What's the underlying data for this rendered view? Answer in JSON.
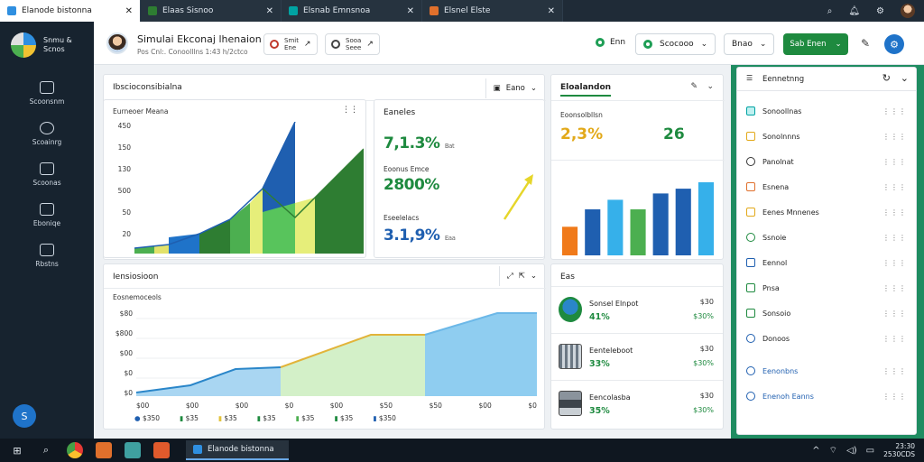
{
  "tabs": [
    {
      "label": "Elanode bistonna",
      "icon": "app-logo-icon",
      "color": "#2f8fe0"
    },
    {
      "label": "Elaas Sisnoo",
      "icon": "grid-icon",
      "color": "#2e7d32"
    },
    {
      "label": "Elsnab Emnsnoa",
      "icon": "grid-icon",
      "color": "#00a3a3"
    },
    {
      "label": "Elsnel Elste",
      "icon": "grid-icon",
      "color": "#e0702c"
    }
  ],
  "sidebar": {
    "brand": {
      "line1": "Snmu &",
      "line2": "Scnos"
    },
    "items": [
      {
        "label": "Scoonsnm",
        "icon": "home-icon"
      },
      {
        "label": "Scoainrg",
        "icon": "clock-icon"
      },
      {
        "label": "Scoonas",
        "icon": "calendar-icon"
      },
      {
        "label": "Eboniqe",
        "icon": "chart-icon"
      },
      {
        "label": "Rbstns",
        "icon": "document-icon"
      }
    ],
    "help": "S"
  },
  "header": {
    "title": "Simulai Ekconaj lhenaion",
    "subtitle": "Pos Cnl:. Conoolllns 1:43 h/2ctco",
    "chip1": {
      "line1": "Smit",
      "line2": "Ene"
    },
    "chip2": {
      "line1": "Sooa",
      "line2": "Seee"
    },
    "status": "Enn",
    "pill_value": "Scocooo",
    "filter": "Bnao",
    "primary": "Sab Enen"
  },
  "card_chart1": {
    "title": "Ibscioconsibialna",
    "control": "Eano",
    "subtitle": "Eurneoer Meana",
    "yticks": [
      "450",
      "150",
      "130",
      "500",
      "50",
      "20"
    ]
  },
  "card_metrics": {
    "title": "Eaneles",
    "m1": {
      "label": "",
      "value": "7,1.3%",
      "unit": "Bat",
      "color": "#1e8a3f"
    },
    "m2": {
      "label": "Eoonus Emce",
      "value": "2800%",
      "unit": "",
      "color": "#1e8a3f"
    },
    "m3": {
      "label": "Eseelelacs",
      "value": "3.1,9%",
      "unit": "Eaa",
      "color": "#1f5fb0"
    }
  },
  "card_bars": {
    "title": "Eloalandon",
    "subtitle": "Eoonsolbllsn",
    "left_value": "2,3%",
    "right_value": "26",
    "chart_data": {
      "type": "bar",
      "values": [
        1.8,
        2.9,
        3.5,
        2.9,
        3.9,
        4.2,
        4.6
      ],
      "colors": [
        "#f07a1a",
        "#1f5fb0",
        "#36b0ea",
        "#4caf50",
        "#1f5fb0",
        "#1f5fb0",
        "#36b0ea"
      ],
      "ylim": [
        0,
        5
      ]
    }
  },
  "card_chart2": {
    "title": "Iensiosioon",
    "subtitle": "Eosnemoceols",
    "yticks": [
      "$80",
      "$800",
      "$00",
      "$0",
      "$0"
    ],
    "xticks": [
      "$00",
      "$00",
      "$00",
      "$0",
      "$00",
      "$50",
      "$50",
      "$00",
      "$0"
    ],
    "legend": [
      {
        "label": "$350",
        "color": "#1f5fb0"
      },
      {
        "label": "$35",
        "color": "#1e8a3f"
      },
      {
        "label": "$35",
        "color": "#e2c23a"
      },
      {
        "label": "$35",
        "color": "#1e8a3f"
      },
      {
        "label": "$35",
        "color": "#4caf50"
      },
      {
        "label": "$35",
        "color": "#1e8a3f"
      },
      {
        "label": "$350",
        "color": "#1f5fb0"
      }
    ]
  },
  "card_list": {
    "title": "Eas",
    "rows": [
      {
        "name": "Sonsel Elnpot",
        "pct": "41%",
        "r1": "$30",
        "r2": "$30%"
      },
      {
        "name": "Eenteleboot",
        "pct": "33%",
        "r1": "$30",
        "r2": "$30%"
      },
      {
        "name": "Eencolasba",
        "pct": "35%",
        "r1": "$30",
        "r2": "$30%"
      }
    ]
  },
  "right_panel": {
    "title": "Eennetnng",
    "items": [
      {
        "label": "Sonoollnas",
        "icon": "checkbox-icon",
        "color": "#00a3a3"
      },
      {
        "label": "Sonolnnns",
        "icon": "edit-icon",
        "color": "#e2a91a"
      },
      {
        "label": "Panolnat",
        "icon": "clock-icon",
        "color": "#333333"
      },
      {
        "label": "Esnena",
        "icon": "folder-icon",
        "color": "#e0702c"
      },
      {
        "label": "Eenes Mnnenes",
        "icon": "mail-icon",
        "color": "#e2a91a"
      },
      {
        "label": "Ssnoie",
        "icon": "location-icon",
        "color": "#1e8a3f"
      },
      {
        "label": "Eennol",
        "icon": "square-icon",
        "color": "#1f5fb0"
      },
      {
        "label": "Pnsa",
        "icon": "refresh-icon",
        "color": "#1e8a3f"
      },
      {
        "label": "Sonsoio",
        "icon": "leaf-icon",
        "color": "#1e8a3f"
      },
      {
        "label": "Donoos",
        "icon": "sync-icon",
        "color": "#1f5fb0"
      },
      {
        "label": "Eenonbns",
        "icon": "info-icon",
        "color": "#1f5fb0"
      },
      {
        "label": "Enenoh Eanns",
        "icon": "info-icon",
        "color": "#1f5fb0"
      }
    ]
  },
  "taskbar": {
    "task_label": "Elanode bistonna",
    "clock_time": "23:30",
    "clock_date": "2530CDS"
  }
}
